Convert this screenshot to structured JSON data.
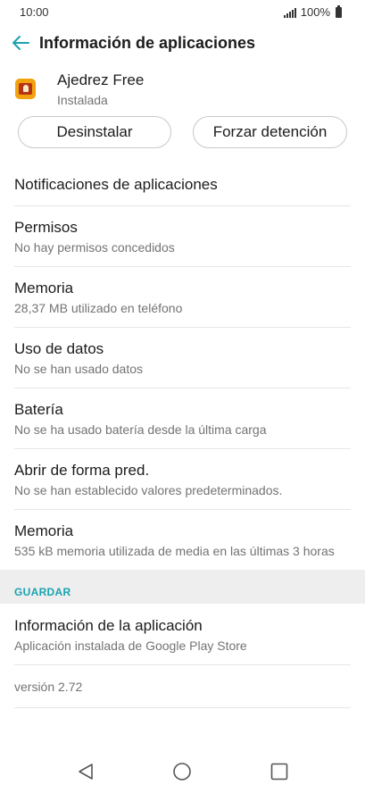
{
  "status_bar": {
    "time": "10:00",
    "battery_level": "100%"
  },
  "header": {
    "title": "Información de aplicaciones"
  },
  "app": {
    "name": "Ajedrez Free",
    "status": "Instalada",
    "icon": "chess-app-icon"
  },
  "actions": {
    "uninstall_label": "Desinstalar",
    "force_stop_label": "Forzar detención"
  },
  "rows": [
    {
      "title": "Notificaciones de aplicaciones",
      "subtitle": ""
    },
    {
      "title": "Permisos",
      "subtitle": "No hay permisos concedidos"
    },
    {
      "title": "Memoria",
      "subtitle": "28,37 MB utilizado en teléfono"
    },
    {
      "title": "Uso de datos",
      "subtitle": "No se han usado datos"
    },
    {
      "title": "Batería",
      "subtitle": "No se ha usado batería desde la última carga"
    },
    {
      "title": "Abrir de forma pred.",
      "subtitle": "No se han establecido valores predeterminados."
    },
    {
      "title": "Memoria",
      "subtitle": "535 kB memoria utilizada de media en las últimas 3 horas"
    }
  ],
  "store_section": {
    "header": "GUARDAR",
    "info_title": "Información de la aplicación",
    "info_subtitle": "Aplicación instalada de Google Play Store",
    "version": "versión 2.72"
  },
  "nav": {
    "back": "back-icon",
    "home": "home-icon",
    "recents": "recents-icon"
  },
  "colors": {
    "accent": "#1aa3b0",
    "section_bg": "#eeeeee",
    "divider": "#e6e6e6",
    "secondary_text": "#737373"
  }
}
